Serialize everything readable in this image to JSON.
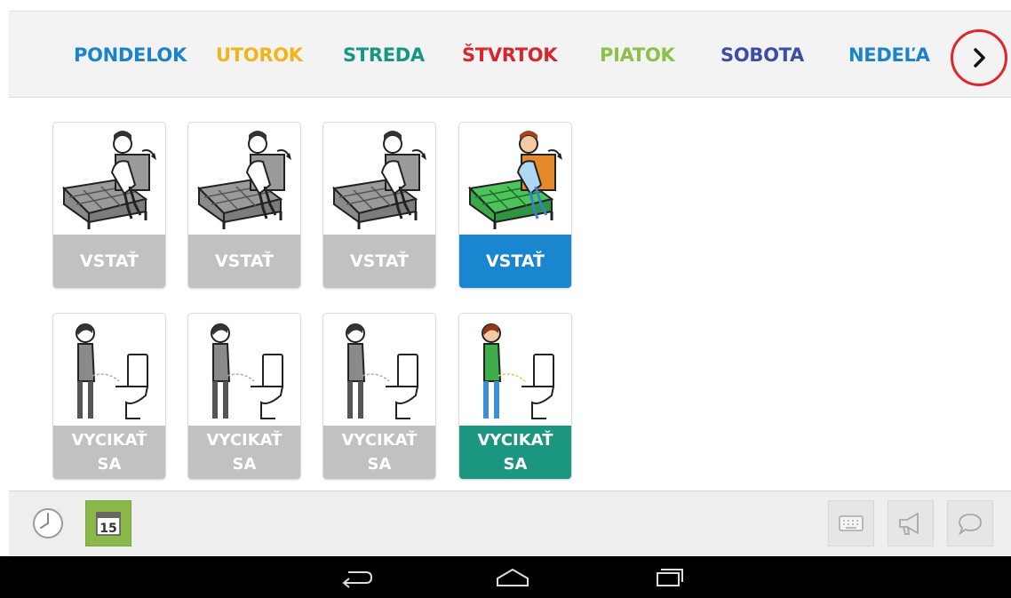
{
  "days": [
    {
      "label": "PONDELOK",
      "color": "#1b84c9"
    },
    {
      "label": "UTOROK",
      "color": "#f2b41c"
    },
    {
      "label": "STREDA",
      "color": "#17977f"
    },
    {
      "label": "ŠTVRTOK",
      "color": "#d8262c"
    },
    {
      "label": "PIATOK",
      "color": "#8cc04b"
    },
    {
      "label": "SOBOTA",
      "color": "#3a4ea8"
    },
    {
      "label": "NEDEĽA",
      "color": "#1b84c9"
    }
  ],
  "next_icon": "chevron-right-icon",
  "activities": [
    {
      "icon": "get-up-from-bed-icon",
      "cards": [
        {
          "label": "VSTAŤ",
          "state": "done",
          "color": "#c1c1c1"
        },
        {
          "label": "VSTAŤ",
          "state": "done",
          "color": "#c1c1c1"
        },
        {
          "label": "VSTAŤ",
          "state": "done",
          "color": "#c1c1c1"
        },
        {
          "label": "VSTAŤ",
          "state": "current",
          "color": "#1a86d0"
        }
      ]
    },
    {
      "icon": "urinate-toilet-icon",
      "cards": [
        {
          "label1": "VYCIKAŤ",
          "label2": "SA",
          "state": "done",
          "color": "#c1c1c1"
        },
        {
          "label1": "VYCIKAŤ",
          "label2": "SA",
          "state": "done",
          "color": "#c1c1c1"
        },
        {
          "label1": "VYCIKAŤ",
          "label2": "SA",
          "state": "done",
          "color": "#c1c1c1"
        },
        {
          "label1": "VYCIKAŤ",
          "label2": "SA",
          "state": "current",
          "color": "#1b9680"
        }
      ]
    }
  ],
  "toolbar": {
    "clock_icon": "clock-icon",
    "calendar_day": "15",
    "calendar_color": "#8bb84a",
    "keyboard_icon": "keyboard-icon",
    "speaker_icon": "megaphone-icon",
    "speech_icon": "speech-bubble-icon"
  },
  "navbar": {
    "back_icon": "back-icon",
    "home_icon": "home-icon",
    "recent_icon": "recent-apps-icon"
  }
}
